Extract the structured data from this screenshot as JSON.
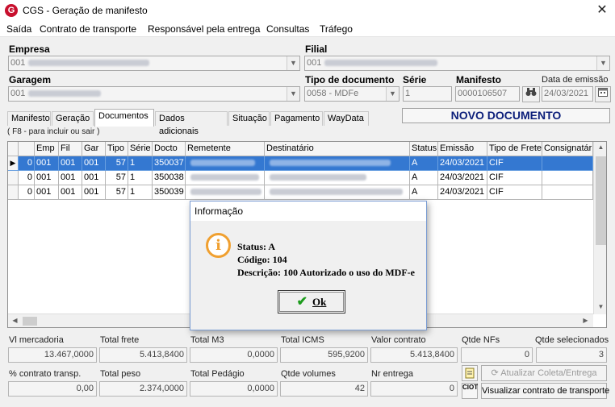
{
  "window": {
    "title": "CGS - Geração de manifesto",
    "close_glyph": "✕",
    "logo": "G"
  },
  "menu": [
    "Saída",
    "Contrato de transporte",
    "Responsável pela entrega",
    "Consultas",
    "Tráfego"
  ],
  "form": {
    "empresa_label": "Empresa",
    "empresa_value": "001",
    "filial_label": "Filial",
    "filial_value": "001",
    "garagem_label": "Garagem",
    "garagem_value": "001",
    "tipo_doc_label": "Tipo de documento",
    "tipo_doc_value": "0058 - MDFe",
    "serie_label": "Série",
    "serie_value": "1",
    "manifesto_label": "Manifesto",
    "manifesto_value": "0000106507",
    "data_emissao_label": "Data de emissão",
    "data_emissao_value": "24/03/2021",
    "search_icon": "binoculars-icon",
    "calendar_icon": "calendar-icon"
  },
  "tabs": [
    "Manifesto",
    "Geração",
    "Documentos",
    "Dados adicionais",
    "Situação",
    "Pagamento",
    "WayData"
  ],
  "active_tab": "Documentos",
  "status_banner": "NOVO DOCUMENTO",
  "hint": "( F8 - para incluir ou sair )",
  "grid": {
    "columns": [
      "",
      "Emp",
      "Fil",
      "Gar",
      "Tipo",
      "Série",
      "Docto",
      "Remetente",
      "Destinatário",
      "Status",
      "Emissão",
      "Tipo de Frete",
      "Consignatári"
    ],
    "rows": [
      {
        "indicator": "▶",
        "c0": "0",
        "emp": "001",
        "fil": "001",
        "gar": "001",
        "tipo": "57",
        "serie": "1",
        "docto": "350037",
        "status": "A",
        "emissao": "24/03/2021",
        "frete": "CIF"
      },
      {
        "indicator": "",
        "c0": "0",
        "emp": "001",
        "fil": "001",
        "gar": "001",
        "tipo": "57",
        "serie": "1",
        "docto": "350038",
        "status": "A",
        "emissao": "24/03/2021",
        "frete": "CIF"
      },
      {
        "indicator": "",
        "c0": "0",
        "emp": "001",
        "fil": "001",
        "gar": "001",
        "tipo": "57",
        "serie": "1",
        "docto": "350039",
        "status": "A",
        "emissao": "24/03/2021",
        "frete": "CIF"
      }
    ]
  },
  "dialog": {
    "title": "Informação",
    "icon": "info-icon",
    "icon_glyph": "i",
    "status": "Status: A",
    "codigo": "Código: 104",
    "descricao": "Descrição: 100 Autorizado o uso do MDF-e",
    "ok_label": "Ok",
    "ok_icon": "✔"
  },
  "totals": {
    "vl_mercadoria_label": "Vl mercadoria",
    "vl_mercadoria": "13.467,0000",
    "total_frete_label": "Total frete",
    "total_frete": "5.413,8400",
    "total_m3_label": "Total M3",
    "total_m3": "0,0000",
    "total_icms_label": "Total ICMS",
    "total_icms": "595,9200",
    "valor_contrato_label": "Valor contrato",
    "valor_contrato": "5.413,8400",
    "qtde_nfs_label": "Qtde NFs",
    "qtde_nfs": "0",
    "qtde_sel_label": "Qtde selecionados",
    "qtde_sel": "3",
    "pct_contrato_label": "% contrato transp.",
    "pct_contrato": "0,00",
    "total_peso_label": "Total peso",
    "total_peso": "2.374,0000",
    "total_pedagio_label": "Total Pedágio",
    "total_pedagio": "0,0000",
    "qtde_volumes_label": "Qtde volumes",
    "qtde_volumes": "42",
    "nr_entrega_label": "Nr entrega",
    "nr_entrega": "0"
  },
  "actions": {
    "atualizar_label": "Atualizar Coleta/Entrega",
    "visualizar_label": "Visualizar contrato de transporte",
    "ciot_icon_text": "CIOT"
  }
}
